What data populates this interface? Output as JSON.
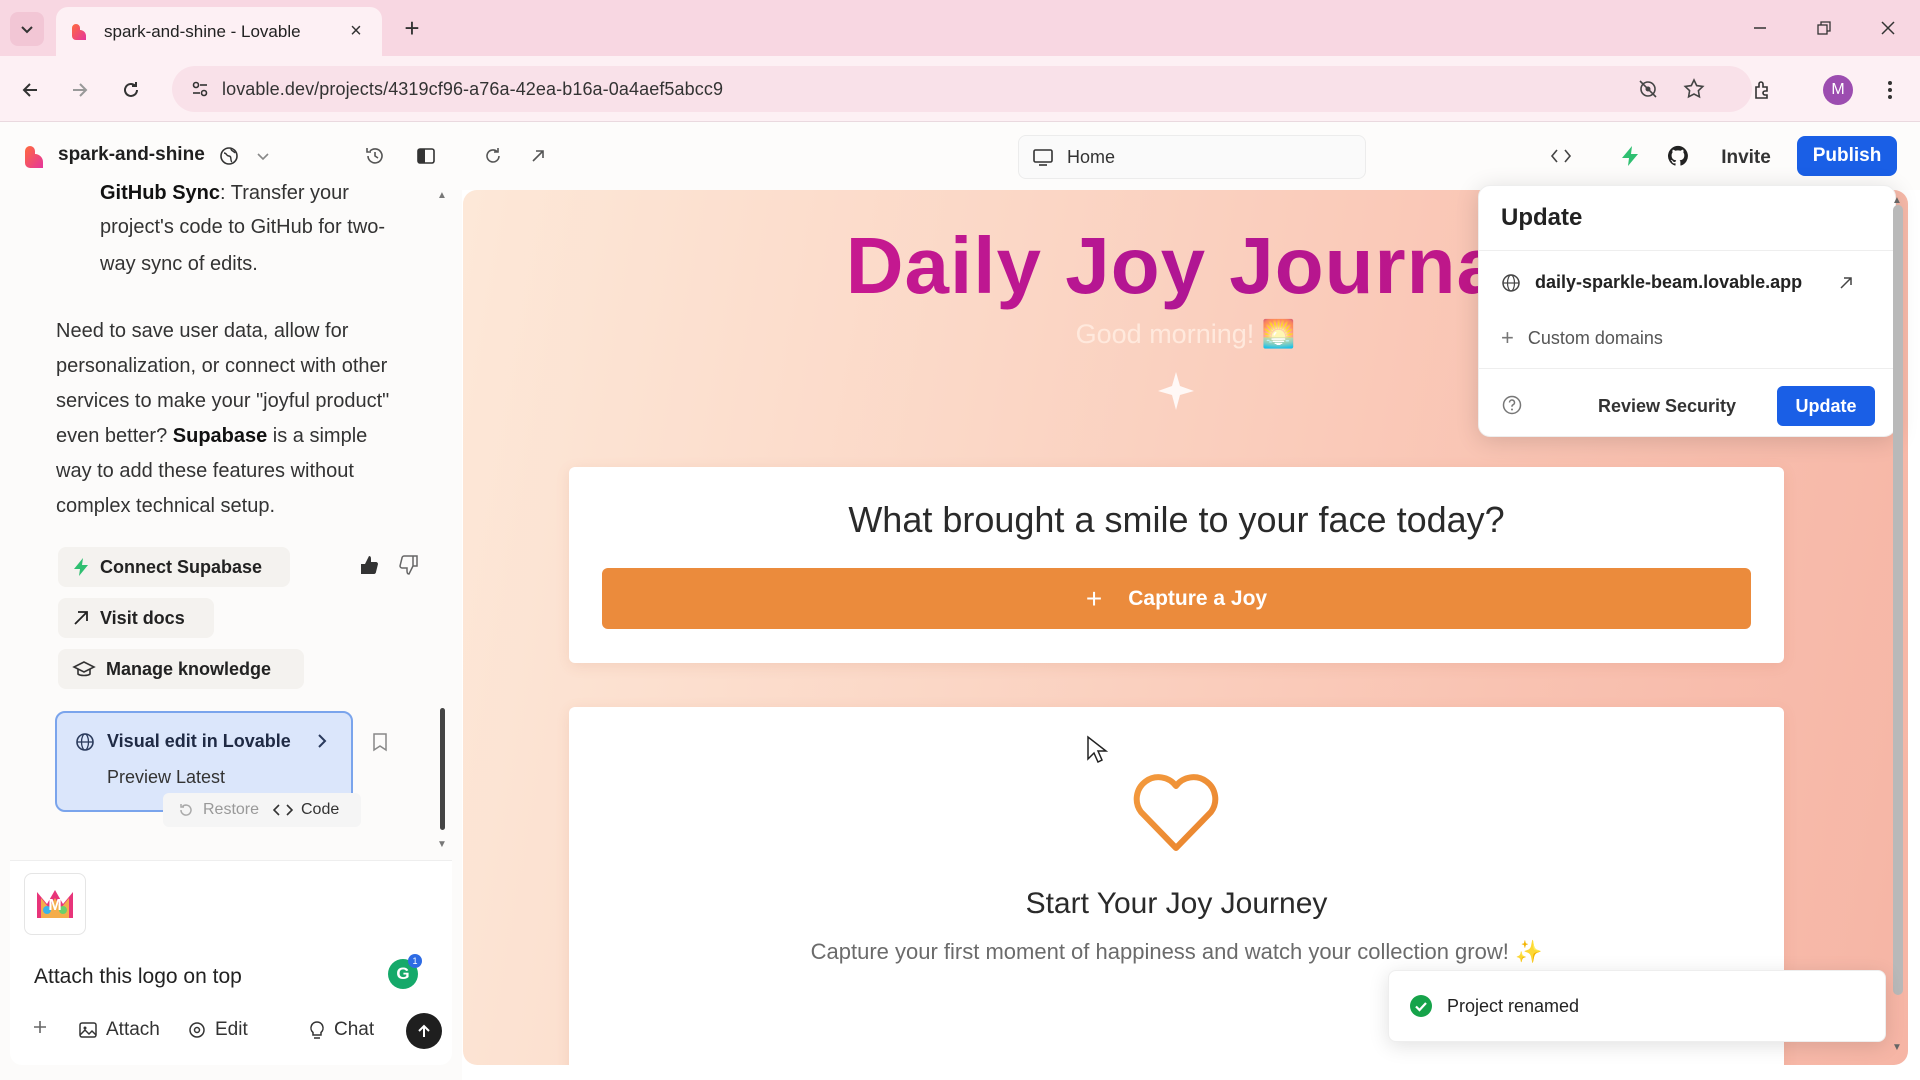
{
  "browser": {
    "tab_title": "spark-and-shine - Lovable",
    "url": "lovable.dev/projects/4319cf96-a76a-42ea-b16a-0a4aef5abcc9",
    "profile_initial": "M"
  },
  "header": {
    "project_name": "spark-and-shine",
    "route": "Home",
    "invite_label": "Invite",
    "publish_label": "Publish"
  },
  "chat": {
    "messages": {
      "github_heading": "GitHub Sync",
      "github_line1": ": Transfer your",
      "github_line2": "project's code to GitHub for two-",
      "github_line3": "way sync of edits.",
      "p_line1": "Need to save user data, allow for",
      "p_line2": "personalization, or connect with other",
      "p_line3": "services to make your \"joyful product\"",
      "p_line4_bold": "even better?",
      "p_supabase": "Supabase",
      "p_line4_rest": " is a simple",
      "p_line5": "way to add these features without",
      "p_line6": "complex technical setup."
    },
    "actions": {
      "connect": "Connect Supabase",
      "docs": "Visit docs",
      "knowledge": "Manage knowledge"
    },
    "version_card": {
      "title": "Visual edit in Lovable",
      "subtitle": "Preview Latest",
      "restore": "Restore",
      "code": "Code"
    },
    "composer": {
      "prompt": "Attach this logo on top",
      "attach": "Attach",
      "edit": "Edit",
      "chat": "Chat",
      "grammarly_count": "1"
    }
  },
  "preview": {
    "title": "Daily Joy Journal",
    "greeting": "Good morning! 🌅",
    "question": "What brought a smile to your face today?",
    "capture_label": "Capture a Joy",
    "empty_title": "Start Your Joy Journey",
    "empty_sub": "Capture your first moment of happiness and watch your collection grow! ✨"
  },
  "popover": {
    "title": "Update",
    "domain": "daily-sparkle-beam.lovable.app",
    "custom_domains": "Custom domains",
    "review_label": "Review Security",
    "update_label": "Update"
  },
  "toast": {
    "message": "Project renamed"
  },
  "colors": {
    "accent_blue": "#1a5fe6",
    "capture_orange": "#eb8b3c",
    "title_magenta": "#c0168f",
    "success_green": "#16a34a"
  }
}
